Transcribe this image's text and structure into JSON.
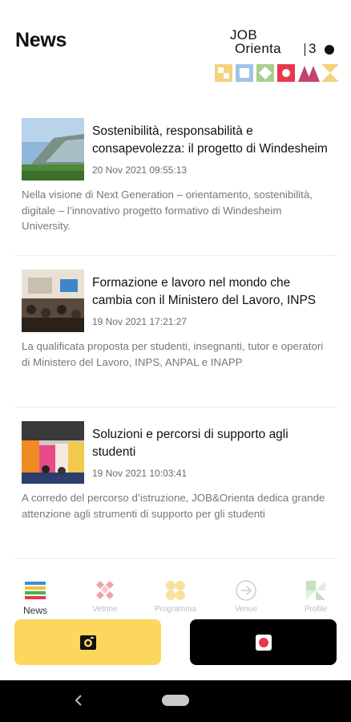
{
  "header": {
    "title": "News",
    "logo": {
      "line1": "JOB",
      "line2": "Orienta",
      "anniversary": "3"
    }
  },
  "news": [
    {
      "title_line1": "Sostenibilità, responsabilità e",
      "title_line2": "consapevolezza: il progetto di Windesheim",
      "date": "20 Nov 2021 09:55:13",
      "excerpt": "Nella visione di Next Generation – orientamento, sostenibilità, digitale – l’innovativo progetto formativo di Windesheim University."
    },
    {
      "title_line1": "Formazione e lavoro nel mondo che",
      "title_line2": "cambia con il Ministero del Lavoro, INPS",
      "date": "19 Nov 2021 17:21:27",
      "excerpt": "La qualificata proposta per studenti, insegnanti, tutor e operatori di Ministero del Lavoro, INPS, ANPAL e INAPP"
    },
    {
      "title_line1": "Soluzioni e percorsi di supporto agli",
      "title_line2": "studenti",
      "date": "19 Nov 2021 10:03:41",
      "excerpt": "A corredo del percorso d’istruzione, JOB&Orienta dedica grande attenzione agli strumenti di supporto per gli studenti"
    }
  ],
  "bottom_nav": [
    {
      "label": "News",
      "icon": "news-stripes-icon",
      "active": true
    },
    {
      "label": "Vetrine",
      "icon": "vetrine-icon",
      "active": false
    },
    {
      "label": "Programma",
      "icon": "programma-icon",
      "active": false
    },
    {
      "label": "Venue",
      "icon": "arrow-circle-icon",
      "active": false
    },
    {
      "label": "Profile",
      "icon": "profile-icon",
      "active": false
    }
  ],
  "actions": {
    "left": {
      "icon": "camera-icon",
      "color": "#fbd75e"
    },
    "right": {
      "icon": "record-icon",
      "color": "#000000"
    }
  },
  "colors": {
    "accent_yellow": "#fbd75e",
    "accent_red": "#e8394a",
    "text_muted": "#777777"
  }
}
